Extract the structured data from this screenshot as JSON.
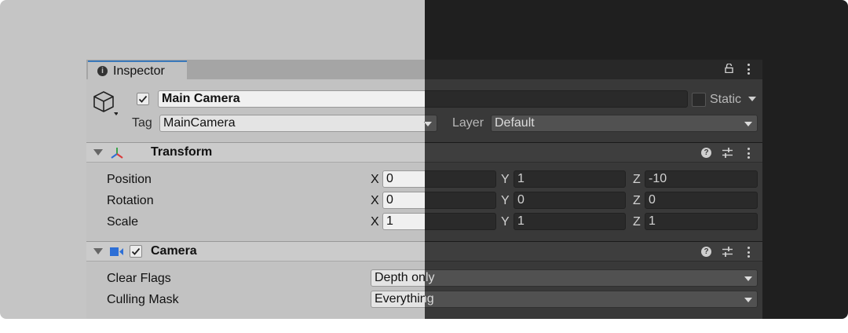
{
  "inspector": {
    "tab_label": "Inspector",
    "game_object": {
      "active": true,
      "name": "Main Camera",
      "static_label": "Static",
      "tag_label": "Tag",
      "tag_value": "MainCamera",
      "layer_label": "Layer",
      "layer_value": "Default"
    },
    "transform": {
      "title": "Transform",
      "rows": [
        {
          "label": "Position",
          "x": "0",
          "y": "1",
          "z": "-10"
        },
        {
          "label": "Rotation",
          "x": "0",
          "y": "0",
          "z": "0"
        },
        {
          "label": "Scale",
          "x": "1",
          "y": "1",
          "z": "1"
        }
      ],
      "axis_labels": {
        "x": "X",
        "y": "Y",
        "z": "Z"
      }
    },
    "camera": {
      "title": "Camera",
      "enabled": true,
      "clear_flags_label": "Clear Flags",
      "clear_flags_value": "Depth only",
      "culling_mask_label": "Culling Mask",
      "culling_mask_value": "Everything"
    }
  },
  "theme": {
    "light_background": "#c5c5c5",
    "dark_background": "#1f1f1f",
    "tab_accent": "#3a79bb",
    "camera_icon_color": "#2d6fd6"
  },
  "icons": [
    "info-icon",
    "lock-icon",
    "kebab-menu-icon",
    "cube-icon",
    "transform-gizmo-icon",
    "camera-icon",
    "help-icon",
    "presets-icon",
    "checkmark-icon"
  ]
}
